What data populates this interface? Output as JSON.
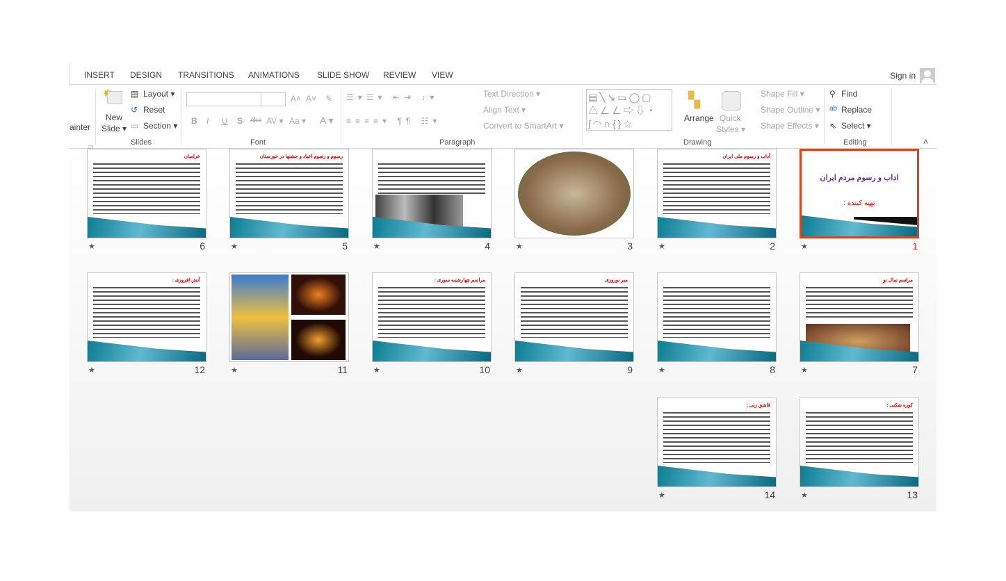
{
  "tabs": [
    "INSERT",
    "DESIGN",
    "TRANSITIONS",
    "ANIMATIONS",
    "SLIDE SHOW",
    "REVIEW",
    "VIEW"
  ],
  "account": {
    "sign_in": "Sign in"
  },
  "ribbon": {
    "clipboard": {
      "painter": "ainter"
    },
    "slides": {
      "new_slide_1": "New",
      "new_slide_2": "Slide ▾",
      "layout": "Layout ▾",
      "reset": "Reset",
      "section": "Section ▾",
      "label": "Slides"
    },
    "font": {
      "label": "Font",
      "bold": "B",
      "italic": "I",
      "underline": "U",
      "shadow": "S",
      "strike": "abc",
      "spacing": "AV ▾",
      "case": "Aa ▾",
      "color": "A ▾",
      "grow": "A˄",
      "shrink": "A˅"
    },
    "paragraph": {
      "label": "Paragraph",
      "text_direction": "Text Direction ▾",
      "align_text": "Align Text ▾",
      "smartart": "Convert to SmartArt ▾"
    },
    "drawing": {
      "label": "Drawing",
      "arrange": "Arrange",
      "quick_styles_1": "Quick",
      "quick_styles_2": "Styles ▾",
      "shape_fill": "Shape Fill ▾",
      "shape_outline": "Shape Outline ▾",
      "shape_effects": "Shape Effects ▾"
    },
    "editing": {
      "label": "Editing",
      "find": "Find",
      "replace": "Replace",
      "select": "Select ▾"
    }
  },
  "accent": "#d24726",
  "slides": [
    {
      "n": "1",
      "title": "اداب و رسوم مردم ایران",
      "subtitle": "تهیه کننده :",
      "selected": true
    },
    {
      "n": "2",
      "title": "آداب و رسوم ملی ایران"
    },
    {
      "n": "3",
      "title": "",
      "image": "photo"
    },
    {
      "n": "4",
      "title": "",
      "image": "relief"
    },
    {
      "n": "5",
      "title": "رسوم و رسوم اعیاد و جشنها در خوزستان"
    },
    {
      "n": "6",
      "title": "خراسان"
    },
    {
      "n": "7",
      "title": "مراسم سال نو",
      "image": "table"
    },
    {
      "n": "8",
      "title": ""
    },
    {
      "n": "9",
      "title": "میر نوروزی"
    },
    {
      "n": "10",
      "title": "مراسم چهارشنبه سوری :"
    },
    {
      "n": "11",
      "title": "",
      "image": "fire"
    },
    {
      "n": "12",
      "title": "آتش افروزی :"
    },
    {
      "n": "13",
      "title": "کوزه شکنی :"
    },
    {
      "n": "14",
      "title": "قاشق زنی :"
    }
  ]
}
